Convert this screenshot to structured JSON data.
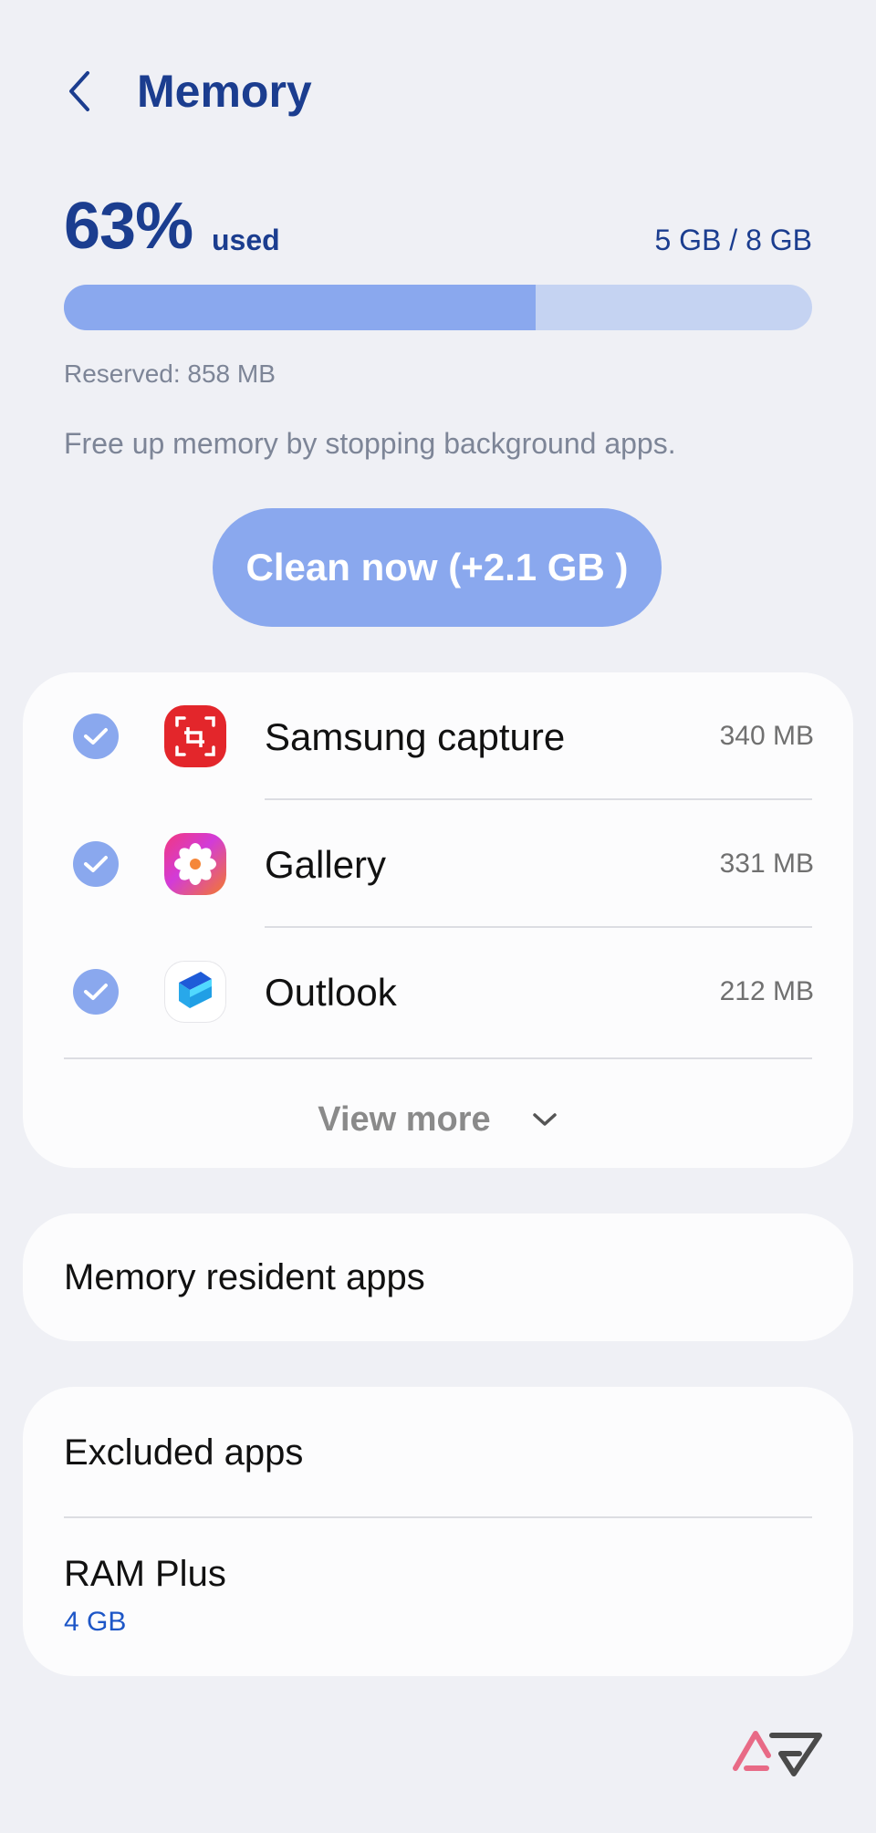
{
  "header": {
    "title": "Memory",
    "back_icon": "chevron-left-icon"
  },
  "usage": {
    "percent_text": "63%",
    "used_label": "used",
    "amount_text": "5 GB / 8 GB",
    "fraction_used": 0.63,
    "reserved_text": "Reserved: 858 MB",
    "hint_text": "Free up memory by stopping background apps."
  },
  "clean_button": {
    "label": "Clean now (+2.1 GB )"
  },
  "apps": [
    {
      "name": "Samsung capture",
      "size": "340 MB",
      "checked": true,
      "icon": "samsung-capture-icon"
    },
    {
      "name": "Gallery",
      "size": "331 MB",
      "checked": true,
      "icon": "gallery-icon"
    },
    {
      "name": "Outlook",
      "size": "212 MB",
      "checked": true,
      "icon": "outlook-icon"
    }
  ],
  "view_more": {
    "label": "View more"
  },
  "resident": {
    "label": "Memory resident apps"
  },
  "settings": {
    "excluded_label": "Excluded apps",
    "ram_plus_label": "RAM Plus",
    "ram_plus_value": "4 GB"
  },
  "colors": {
    "accent": "#8aa8ee",
    "title_blue": "#1b3d8f",
    "link_blue": "#1d56c7",
    "background": "#eff0f5"
  }
}
